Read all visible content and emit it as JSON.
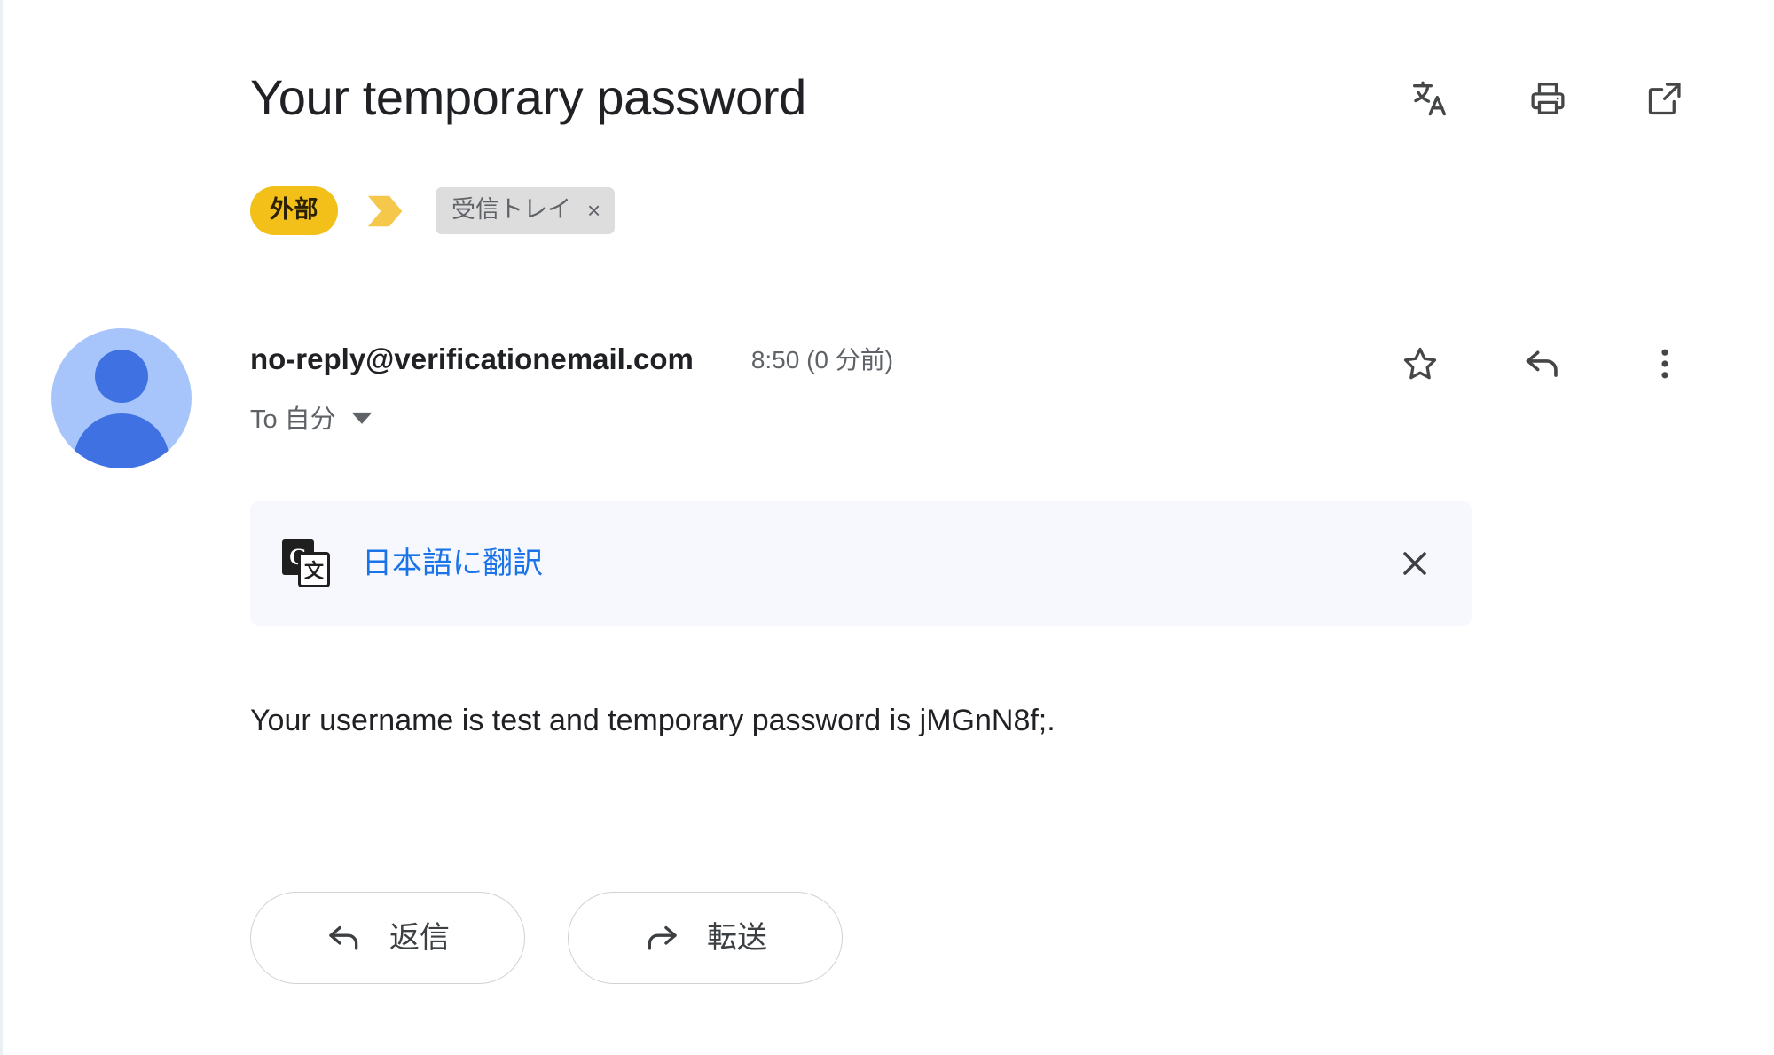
{
  "message": {
    "subject": "Your temporary password",
    "external_badge": "外部",
    "important_marker_icon": "important-chevron-icon",
    "labels": [
      {
        "name": "受信トレイ",
        "remove_label": "×"
      }
    ],
    "header_actions": [
      {
        "name": "translate-icon",
        "label": "文A"
      },
      {
        "name": "print-icon",
        "label": "印刷"
      },
      {
        "name": "open-in-new-icon",
        "label": "新しいウィンドウで開く"
      }
    ],
    "sender": {
      "email": "no-reply@verificationemail.com",
      "time": "8:50 (0 分前)",
      "to": "To 自分",
      "to_expand_icon": "chevron-down-icon",
      "avatar_icon": "person-avatar-icon"
    },
    "sender_actions": [
      {
        "name": "star-icon",
        "label": "スター付き"
      },
      {
        "name": "reply-icon",
        "label": "返信"
      },
      {
        "name": "more-options-icon",
        "label": "その他"
      }
    ],
    "translate_banner": {
      "icon": "google-translate-icon",
      "icon_left_glyph": "G",
      "icon_right_glyph": "文",
      "link_text": "日本語に翻訳",
      "close_icon": "close-icon"
    },
    "body_text": "Your username is test and temporary password is jMGnN8f;.",
    "footer_buttons": [
      {
        "name": "reply-button",
        "label": "返信",
        "icon": "reply-arrow-icon"
      },
      {
        "name": "forward-button",
        "label": "転送",
        "icon": "forward-arrow-icon"
      }
    ]
  },
  "colors": {
    "external_badge_bg": "#f2c018",
    "important_marker": "#f5c84b",
    "label_chip_bg": "#ddddde",
    "translate_banner_bg": "#f6f8fd",
    "translate_link": "#1a73e8",
    "avatar_bg": "#a7c5fb",
    "avatar_fg": "#4071e3",
    "text_primary": "#202124",
    "text_secondary": "#5f6368"
  }
}
